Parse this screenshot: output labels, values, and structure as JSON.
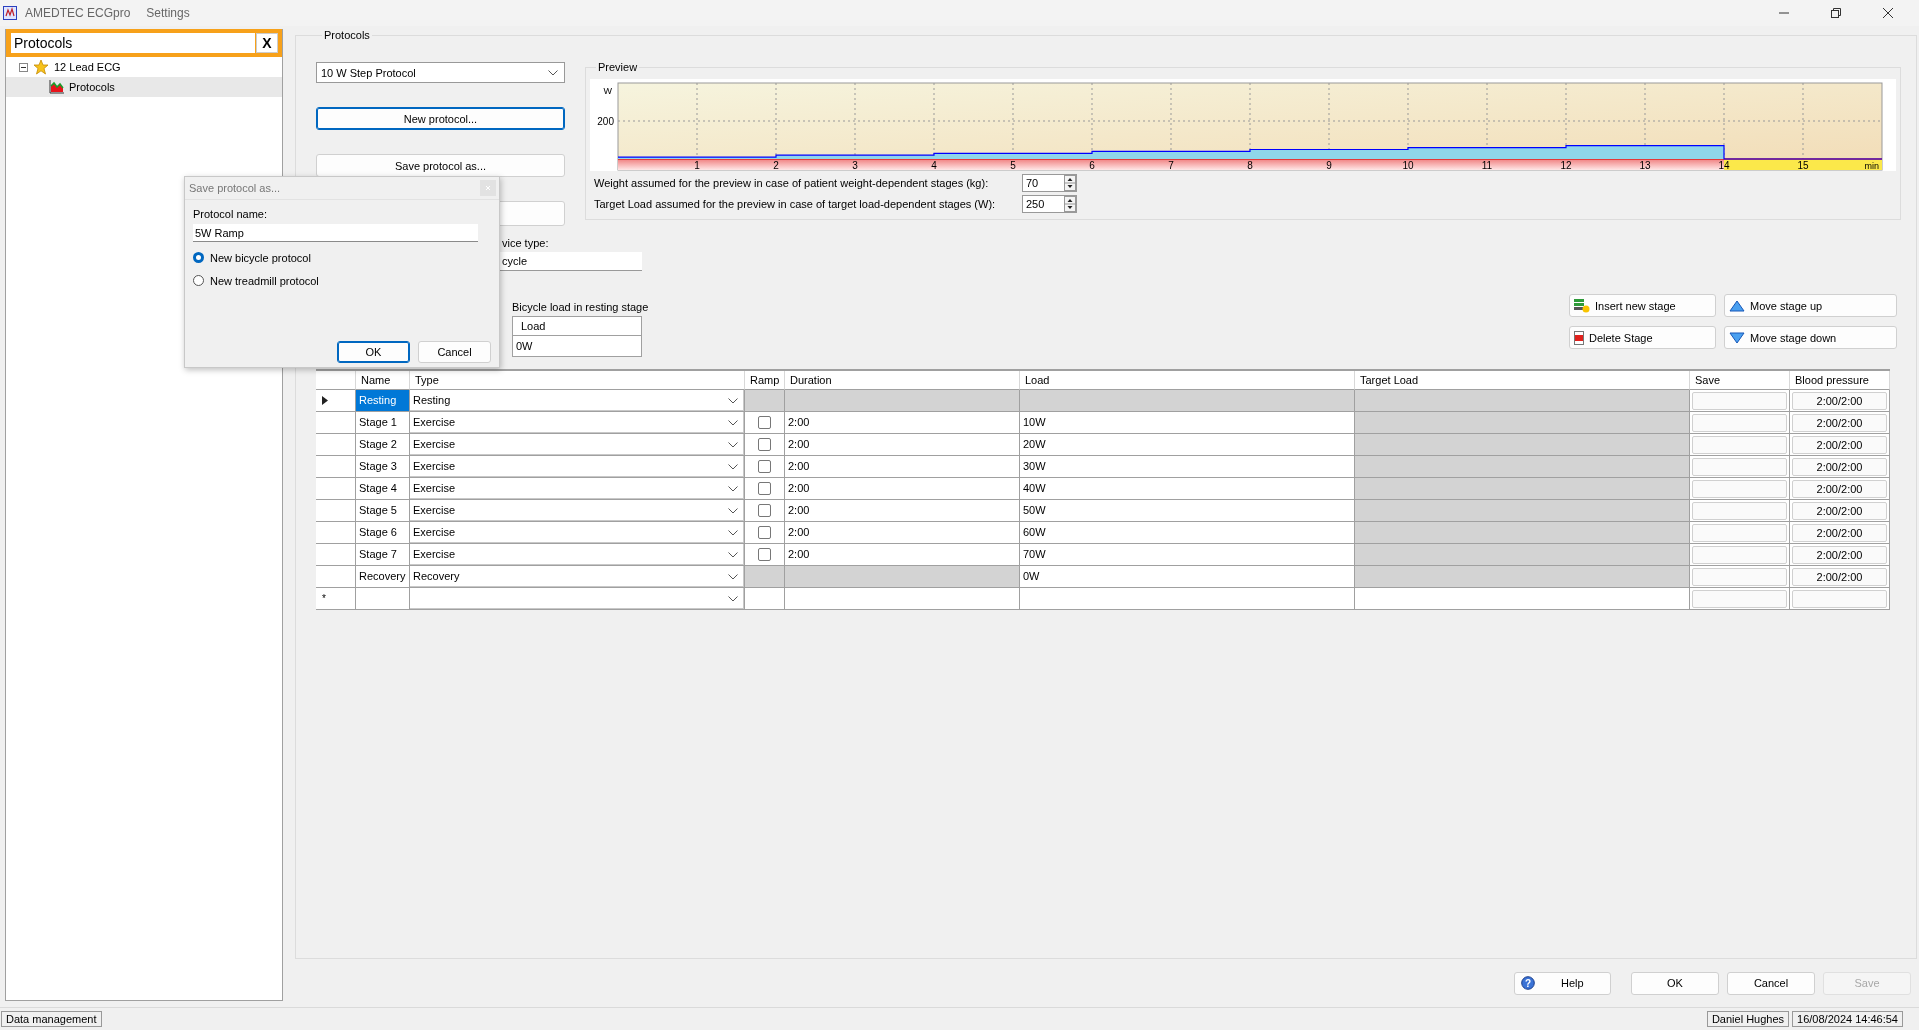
{
  "window": {
    "title": "AMEDTEC ECGpro",
    "subtitle": "Settings"
  },
  "sidebar": {
    "search": {
      "value": "Protocols",
      "clear_label": "X"
    },
    "tree": [
      {
        "label": "12 Lead ECG",
        "expanded": true,
        "selected": false,
        "children": [
          {
            "label": "Protocols",
            "selected": true
          }
        ]
      }
    ]
  },
  "protocols": {
    "title": "Protocols",
    "protocol_select": {
      "value": "10 W Step Protocol"
    },
    "buttons": [
      "New protocol...",
      "Save protocol as..."
    ],
    "device_type": {
      "label": "vice type:",
      "value": "cycle"
    },
    "resting_load": {
      "label": "Bicycle load in resting stage",
      "header": "Load",
      "value": "0W"
    },
    "stage_buttons": [
      {
        "kind": "insert",
        "label": "Insert new stage"
      },
      {
        "kind": "up",
        "label": "Move stage up"
      },
      {
        "kind": "delete",
        "label": "Delete Stage"
      },
      {
        "kind": "down",
        "label": "Move stage down"
      }
    ]
  },
  "preview": {
    "title": "Preview",
    "chart": {
      "kind": "picture",
      "y_labels": [
        "W",
        "200"
      ],
      "x_labels": [
        "1",
        "2",
        "3",
        "4",
        "5",
        "6",
        "7",
        "8",
        "9",
        "10",
        "11",
        "12",
        "13",
        "14",
        "15"
      ],
      "x_unit": "min"
    },
    "weight": {
      "label": "Weight assumed for the preview in case of patient weight-dependent stages (kg):",
      "value": "70"
    },
    "target": {
      "label": "Target Load assumed for the preview in case of target load-dependent stages (W):",
      "value": "250"
    }
  },
  "table": {
    "columns": [
      "Name",
      "Type",
      "Ramp",
      "Duration",
      "Load",
      "Target Load",
      "Save",
      "Blood pressure"
    ],
    "rows": [
      {
        "kind": "resting",
        "current": true,
        "selected": true,
        "name": "Resting",
        "type": "Resting",
        "blood_pressure": "2:00/2:00"
      },
      {
        "kind": "exercise",
        "current": false,
        "selected": false,
        "name": "Stage 1",
        "type": "Exercise",
        "ramp": false,
        "duration": "2:00",
        "load": "10W",
        "blood_pressure": "2:00/2:00"
      },
      {
        "kind": "exercise",
        "current": false,
        "selected": false,
        "name": "Stage 2",
        "type": "Exercise",
        "ramp": false,
        "duration": "2:00",
        "load": "20W",
        "blood_pressure": "2:00/2:00"
      },
      {
        "kind": "exercise",
        "current": false,
        "selected": false,
        "name": "Stage 3",
        "type": "Exercise",
        "ramp": false,
        "duration": "2:00",
        "load": "30W",
        "blood_pressure": "2:00/2:00"
      },
      {
        "kind": "exercise",
        "current": false,
        "selected": false,
        "name": "Stage 4",
        "type": "Exercise",
        "ramp": false,
        "duration": "2:00",
        "load": "40W",
        "blood_pressure": "2:00/2:00"
      },
      {
        "kind": "exercise",
        "current": false,
        "selected": false,
        "name": "Stage 5",
        "type": "Exercise",
        "ramp": false,
        "duration": "2:00",
        "load": "50W",
        "blood_pressure": "2:00/2:00"
      },
      {
        "kind": "exercise",
        "current": false,
        "selected": false,
        "name": "Stage 6",
        "type": "Exercise",
        "ramp": false,
        "duration": "2:00",
        "load": "60W",
        "blood_pressure": "2:00/2:00"
      },
      {
        "kind": "exercise",
        "current": false,
        "selected": false,
        "name": "Stage 7",
        "type": "Exercise",
        "ramp": false,
        "duration": "2:00",
        "load": "70W",
        "blood_pressure": "2:00/2:00"
      },
      {
        "kind": "recovery",
        "current": false,
        "selected": false,
        "name": "Recovery",
        "type": "Recovery",
        "load": "0W",
        "blood_pressure": "2:00/2:00"
      },
      {
        "kind": "new",
        "current": false,
        "selected": false,
        "marker": "*"
      }
    ]
  },
  "footer_buttons": [
    {
      "kind": "help",
      "label": "Help",
      "icon": "?",
      "disabled": false
    },
    {
      "kind": "ok",
      "label": "OK",
      "disabled": false
    },
    {
      "kind": "cancel",
      "label": "Cancel",
      "disabled": false
    },
    {
      "kind": "save",
      "label": "Save",
      "disabled": true
    }
  ],
  "status_bar": {
    "left": "Data management",
    "user": "Daniel Hughes",
    "datetime": "16/08/2024 14:46:54"
  },
  "dialog": {
    "title": "Save protocol as...",
    "name_label": "Protocol name:",
    "name_value": "5W Ramp",
    "options": [
      {
        "label": "New bicycle protocol",
        "selected": true
      },
      {
        "label": "New treadmill protocol",
        "selected": false
      }
    ],
    "buttons": [
      {
        "kind": "ok",
        "label": "OK"
      },
      {
        "kind": "cancel",
        "label": "Cancel"
      }
    ]
  }
}
